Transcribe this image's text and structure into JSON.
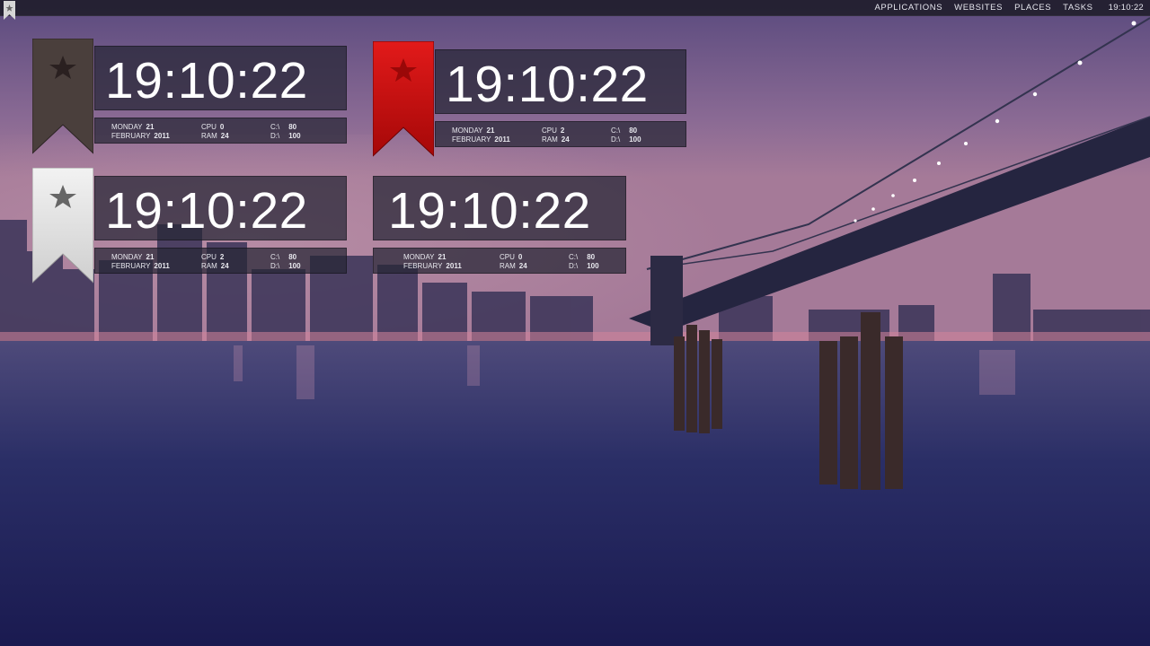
{
  "topbar": {
    "menu": [
      "APPLICATIONS",
      "WEBSITES",
      "PLACES",
      "TASKS"
    ],
    "clock": "19:10:22",
    "ribbon_icon": "bookmark-ribbon-icon"
  },
  "widgets": [
    {
      "ribbon_color": "#4a3f3c",
      "time": "19:10:22",
      "day_label": "MONDAY",
      "day_value": "21",
      "month_label": "FEBRUARY",
      "year_value": "2011",
      "cpu_label": "CPU",
      "cpu_value": "0",
      "ram_label": "RAM",
      "ram_value": "24",
      "c_label": "C:\\",
      "c_value": "80",
      "d_label": "D:\\",
      "d_value": "100"
    },
    {
      "ribbon_color": "#d01010",
      "time": "19:10:22",
      "day_label": "MONDAY",
      "day_value": "21",
      "month_label": "FEBRUARY",
      "year_value": "2011",
      "cpu_label": "CPU",
      "cpu_value": "2",
      "ram_label": "RAM",
      "ram_value": "24",
      "c_label": "C:\\",
      "c_value": "80",
      "d_label": "D:\\",
      "d_value": "100"
    },
    {
      "ribbon_color": "#e6e6e6",
      "time": "19:10:22",
      "day_label": "MONDAY",
      "day_value": "21",
      "month_label": "FEBRUARY",
      "year_value": "2011",
      "cpu_label": "CPU",
      "cpu_value": "2",
      "ram_label": "RAM",
      "ram_value": "24",
      "c_label": "C:\\",
      "c_value": "80",
      "d_label": "D:\\",
      "d_value": "100"
    },
    {
      "ribbon_color": "",
      "time": "19:10:22",
      "day_label": "MONDAY",
      "day_value": "21",
      "month_label": "FEBRUARY",
      "year_value": "2011",
      "cpu_label": "CPU",
      "cpu_value": "0",
      "ram_label": "RAM",
      "ram_value": "24",
      "c_label": "C:\\",
      "c_value": "80",
      "d_label": "D:\\",
      "d_value": "100"
    }
  ]
}
